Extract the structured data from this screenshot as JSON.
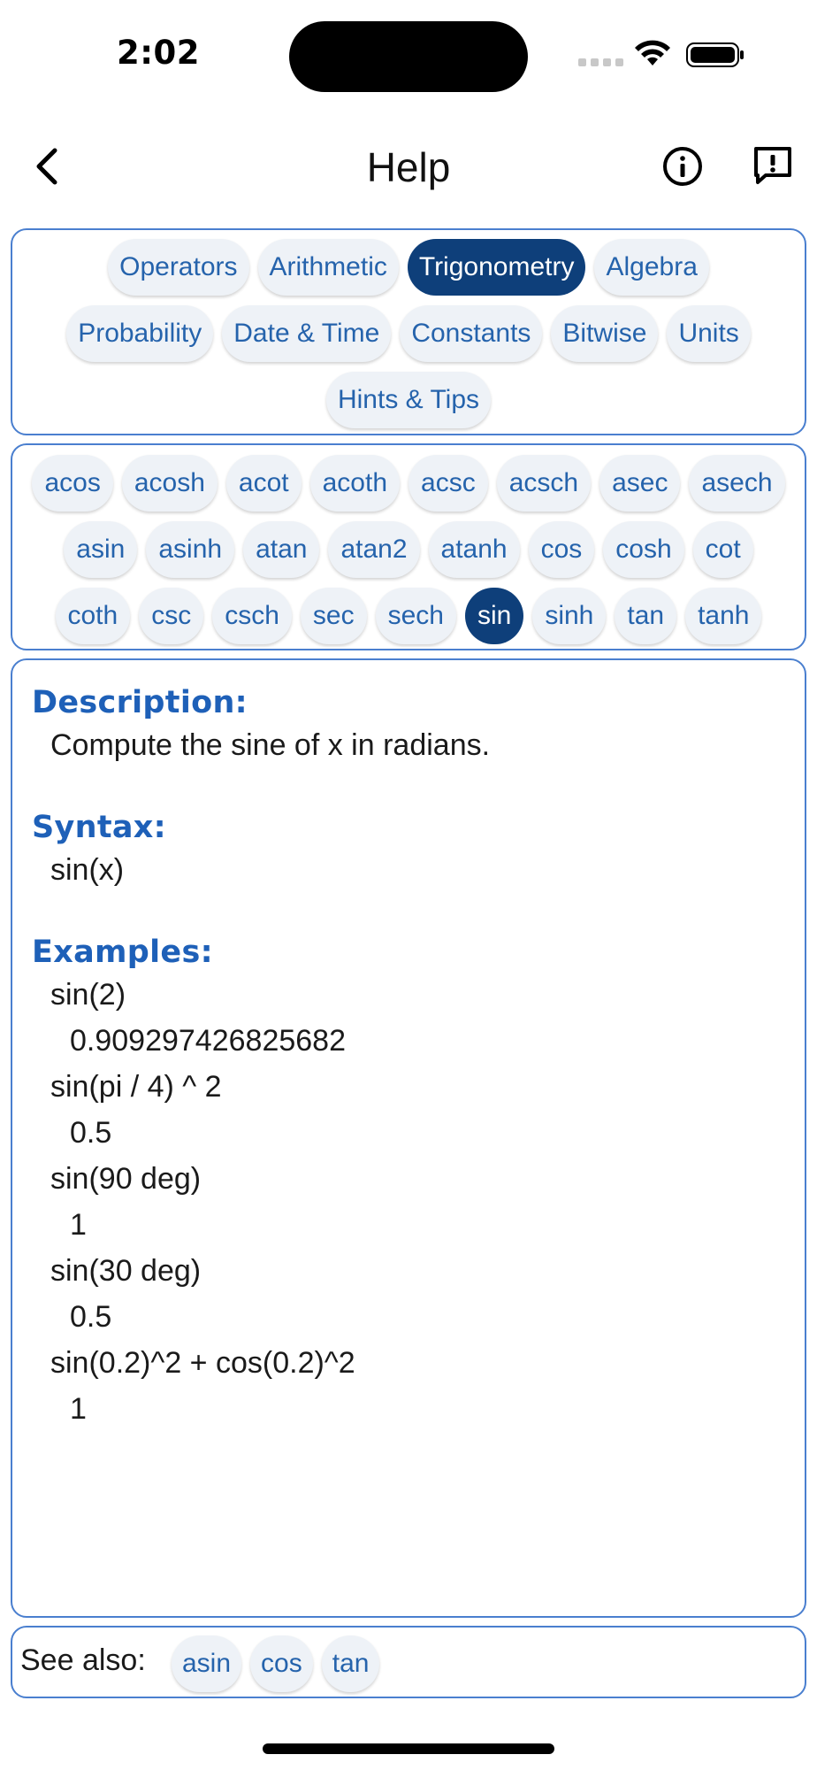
{
  "status_bar": {
    "time": "2:02"
  },
  "nav": {
    "title": "Help"
  },
  "categories": {
    "rows": [
      [
        "Operators",
        "Arithmetic",
        "Trigonometry",
        "Algebra"
      ],
      [
        "Probability",
        "Date & Time",
        "Constants",
        "Bitwise",
        "Units"
      ],
      [
        "Hints & Tips"
      ]
    ],
    "selected": "Trigonometry"
  },
  "functions": {
    "rows": [
      [
        "acos",
        "acosh",
        "acot",
        "acoth",
        "acsc",
        "acsch",
        "asec",
        "asech"
      ],
      [
        "asin",
        "asinh",
        "atan",
        "atan2",
        "atanh",
        "cos",
        "cosh",
        "cot"
      ],
      [
        "coth",
        "csc",
        "csch",
        "sec",
        "sech",
        "sin",
        "sinh",
        "tan",
        "tanh"
      ]
    ],
    "selected": "sin"
  },
  "content": {
    "description_label": "Description:",
    "description": "Compute the sine of x in radians.",
    "syntax_label": "Syntax:",
    "syntax": "sin(x)",
    "examples_label": "Examples:",
    "examples": [
      {
        "expr": "sin(2)",
        "result": "0.909297426825682"
      },
      {
        "expr": "sin(pi / 4) ^ 2",
        "result": "0.5"
      },
      {
        "expr": "sin(90 deg)",
        "result": "1"
      },
      {
        "expr": "sin(30 deg)",
        "result": "0.5"
      },
      {
        "expr": "sin(0.2)^2 + cos(0.2)^2",
        "result": "1"
      }
    ]
  },
  "see_also": {
    "label": "See also:",
    "items": [
      "asin",
      "cos",
      "tan"
    ]
  },
  "colors": {
    "accent": "#2563ac",
    "selected_chip": "#0e3f7a",
    "panel_border": "#4a7fcf",
    "section_heading": "#1e60b8"
  },
  "icons": {
    "back": "chevron-left-icon",
    "info": "info-circle-icon",
    "feedback": "feedback-icon"
  }
}
